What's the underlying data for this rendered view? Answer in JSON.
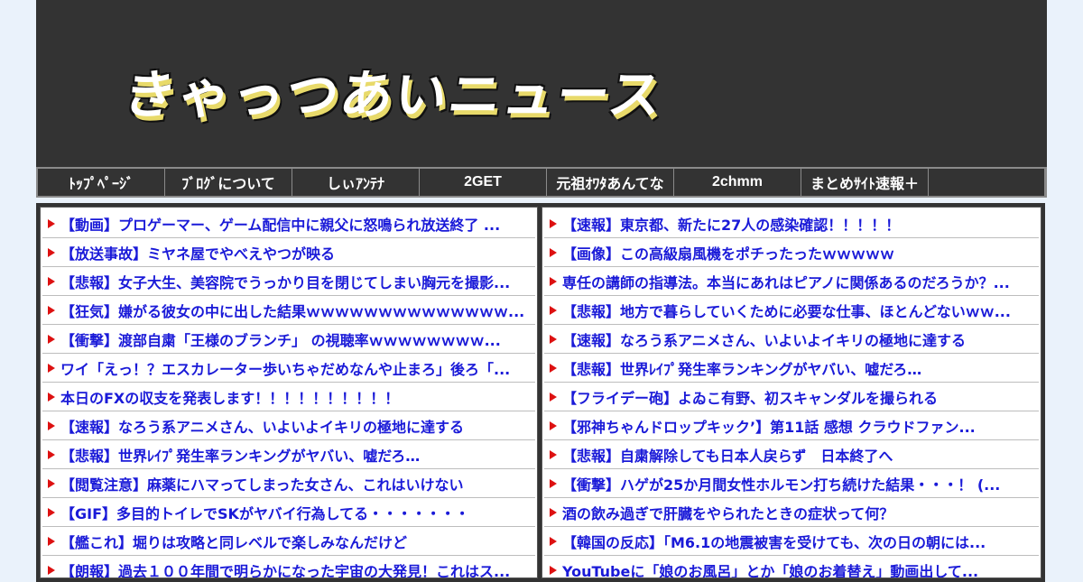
{
  "site": {
    "title": "きゃっつあいニュース"
  },
  "nav": [
    {
      "label": "ﾄｯﾌﾟﾍﾟｰｼﾞ"
    },
    {
      "label": "ﾌﾞﾛｸﾞについて"
    },
    {
      "label": "しぃｱﾝﾃﾅ"
    },
    {
      "label": "2GET"
    },
    {
      "label": "元祖ｵﾜﾀあんてな"
    },
    {
      "label": "2chmm"
    },
    {
      "label": "まとめｻｲﾄ速報＋"
    },
    {
      "label": ""
    }
  ],
  "left_articles": [
    {
      "title": "【動画】プロゲーマー、ゲーム配信中に親父に怒鳴られ放送終了 ..."
    },
    {
      "title": "【放送事故】ミヤネ屋でやべえやつが映る"
    },
    {
      "title": "【悲報】女子大生、美容院でうっかり目を閉じてしまい胸元を撮影..."
    },
    {
      "title": "【狂気】嫌がる彼女の中に出した結果ｗｗｗｗｗｗｗｗｗｗｗｗｗｗ..."
    },
    {
      "title": "【衝撃】渡部自粛「王様のブランチ」 の視聴率ｗｗｗｗｗｗｗｗ..."
    },
    {
      "title": "ワイ「えっ！？エスカレーター歩いちゃだめなんや止まろ」後ろ「..."
    },
    {
      "title": "本日のFXの収支を発表します！！！！！！！！！！"
    },
    {
      "title": "【速報】なろう系アニメさん、いよいよイキリの極地に達する"
    },
    {
      "title": "【悲報】世界ﾚｲﾌﾟ発生率ランキングがヤバい、嘘だろ…"
    },
    {
      "title": "【閲覧注意】麻薬にハマってしまった女さん、これはいけない"
    },
    {
      "title": "【GIF】多目的トイレでSKがヤバイ行為してる・・・・・・・"
    },
    {
      "title": "【艦これ】堀りは攻略と同レベルで楽しみなんだけど"
    },
    {
      "title": "【朗報】過去１００年間で明らかになった宇宙の大発見！これはス..."
    }
  ],
  "right_articles": [
    {
      "title": "【速報】東京都、新たに27人の感染確認！！！！！"
    },
    {
      "title": "【画像】この高級扇風機をポチったったｗｗｗｗｗ"
    },
    {
      "title": "専任の講師の指導法。本当にあれはピアノに関係あるのだろうか？..."
    },
    {
      "title": "【悲報】地方で暮らしていくために必要な仕事、ほとんどないｗｗ..."
    },
    {
      "title": "【速報】なろう系アニメさん、いよいよイキリの極地に達する"
    },
    {
      "title": "【悲報】世界ﾚｲﾌﾟ発生率ランキングがヤバい、嘘だろ…"
    },
    {
      "title": "【フライデー砲】よゐこ有野、初スキャンダルを撮られる"
    },
    {
      "title": "【邪神ちゃんドロップキック’】第11話 感想 クラウドファン..."
    },
    {
      "title": "【悲報】自粛解除しても日本人戻らず　日本終了へ"
    },
    {
      "title": "【衝撃】ハゲが25か月間女性ホルモン打ち続けた結果・・・！ (..."
    },
    {
      "title": "酒の飲み過ぎで肝臓をやられたときの症状って何？"
    },
    {
      "title": "【韓国の反応】「M6.1の地震被害を受けても、次の日の朝には..."
    },
    {
      "title": "YouTubeに「娘のお風呂」とか「娘のお着替え」動画出して..."
    }
  ],
  "colors": {
    "banner_bg": "#333333",
    "logo_shadow": "#e8da6a",
    "link": "#1a1ad8",
    "arrow": "#dd1111"
  }
}
